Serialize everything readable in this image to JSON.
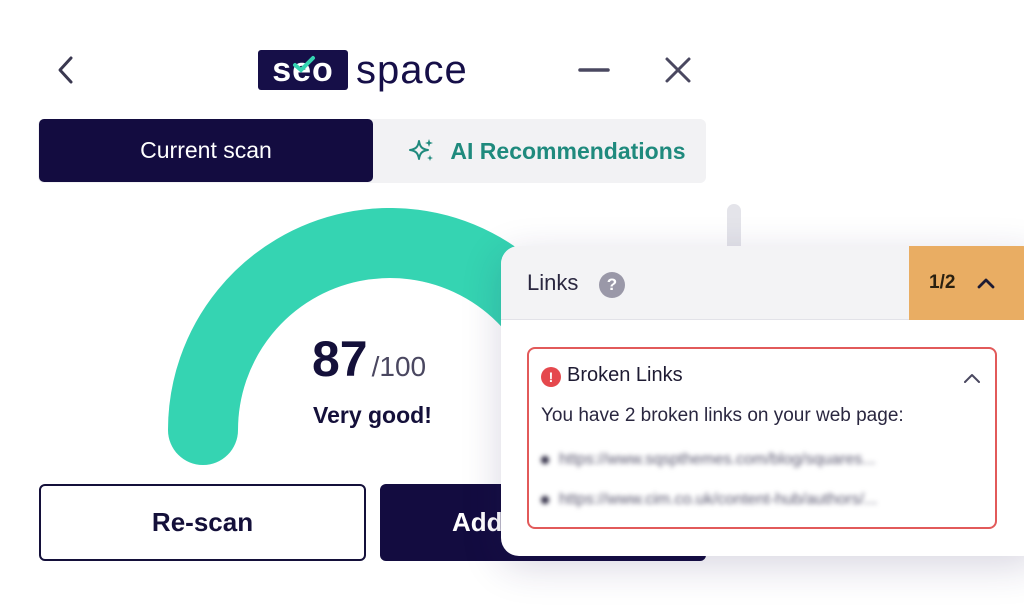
{
  "header": {
    "logo_box_text": "seo",
    "logo_text": "space"
  },
  "tabs": [
    {
      "label": "Current scan",
      "active": true
    },
    {
      "label": "AI Recommendations",
      "active": false
    }
  ],
  "score": {
    "value": "87",
    "max": "/100",
    "fraction": 0.87,
    "label": "Very good!"
  },
  "buttons": {
    "rescan": "Re-scan",
    "add": "Add"
  },
  "card": {
    "title": "Links",
    "help_icon": "?",
    "pager": "1/2",
    "issue": {
      "title": "Broken Links",
      "description": "You have 2 broken links on your web page:",
      "links": [
        "https://www.sqspthemes.com/blog/squares...",
        "https://www.cim.co.uk/content-hub/authors/..."
      ]
    }
  },
  "colors": {
    "navy": "#130c40",
    "teal": "#35d4b2",
    "ai_teal": "#1f8a7d",
    "orange": "#e9ad63",
    "error_red": "#e5484d"
  }
}
